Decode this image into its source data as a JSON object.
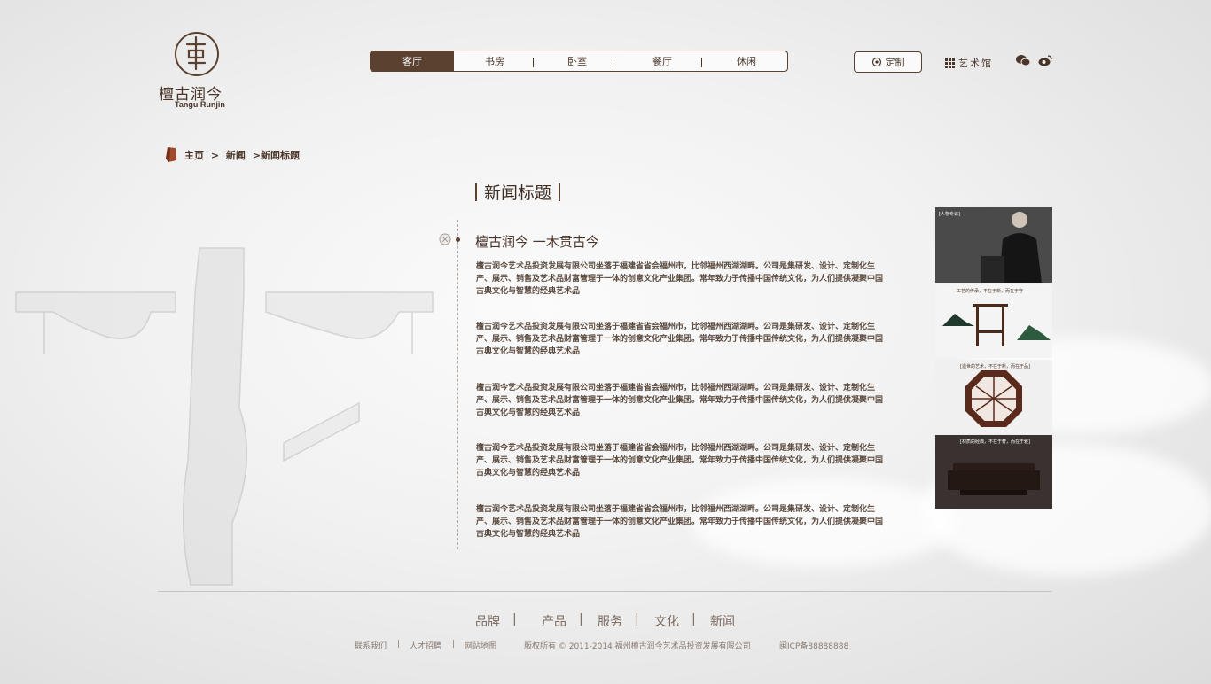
{
  "logo": {
    "cn": "檀古润今",
    "en": "Tangu Runjin"
  },
  "nav": {
    "items": [
      {
        "label": "客厅",
        "active": true
      },
      {
        "label": "书房",
        "active": false
      },
      {
        "label": "卧室",
        "active": false
      },
      {
        "label": "餐厅",
        "active": false
      },
      {
        "label": "休闲",
        "active": false
      }
    ]
  },
  "header": {
    "custom_label": "定制",
    "gallery_label": "艺术馆"
  },
  "breadcrumb": {
    "home": "主页",
    "sep1": ">",
    "news": "新闻",
    "sep2": ">",
    "current": "新闻标题"
  },
  "page_title": "新闻标题",
  "article": {
    "title": "檀古润今 一木贯古今",
    "paragraphs": [
      "檀古润今艺术品投资发展有限公司坐落于福建省省会福州市，比邻福州西湖湖畔。公司是集研发、设计、定制化生产、展示、销售及艺术品财富管理于一体的创意文化产业集团。常年致力于传播中国传统文化，为人们提供凝聚中国古典文化与智慧的经典艺术品",
      "檀古润今艺术品投资发展有限公司坐落于福建省省会福州市，比邻福州西湖湖畔。公司是集研发、设计、定制化生产、展示、销售及艺术品财富管理于一体的创意文化产业集团。常年致力于传播中国传统文化，为人们提供凝聚中国古典文化与智慧的经典艺术品",
      "檀古润今艺术品投资发展有限公司坐落于福建省省会福州市，比邻福州西湖湖畔。公司是集研发、设计、定制化生产、展示、销售及艺术品财富管理于一体的创意文化产业集团。常年致力于传播中国传统文化，为人们提供凝聚中国古典文化与智慧的经典艺术品",
      "檀古润今艺术品投资发展有限公司坐落于福建省省会福州市，比邻福州西湖湖畔。公司是集研发、设计、定制化生产、展示、销售及艺术品财富管理于一体的创意文化产业集团。常年致力于传播中国传统文化，为人们提供凝聚中国古典文化与智慧的经典艺术品",
      "檀古润今艺术品投资发展有限公司坐落于福建省省会福州市，比邻福州西湖湖畔。公司是集研发、设计、定制化生产、展示、销售及艺术品财富管理于一体的创意文化产业集团。常年致力于传播中国传统文化，为人们提供凝聚中国古典文化与智慧的经典艺术品"
    ]
  },
  "side_panels": [
    {
      "tag": "[人物专访]"
    },
    {
      "tag": "工艺的传承，不在于新，而在于守"
    },
    {
      "tag": "[遗世的艺术，不在于新，而在于品]"
    },
    {
      "tag": "[材质的经典，不在于奢，而在于雅]"
    }
  ],
  "footer": {
    "nav": [
      "品牌",
      "产品",
      "服务",
      "文化",
      "新闻"
    ],
    "links": [
      "联系我们",
      "人才招聘",
      "网站地图"
    ],
    "copyright": "版权所有 © 2011-2014 福州檀古润今艺术品投资发展有限公司",
    "icp": "闽ICP备88888888"
  },
  "colors": {
    "brand": "#5b4130",
    "text": "#5a4a3f",
    "line": "#c9c2bc"
  }
}
